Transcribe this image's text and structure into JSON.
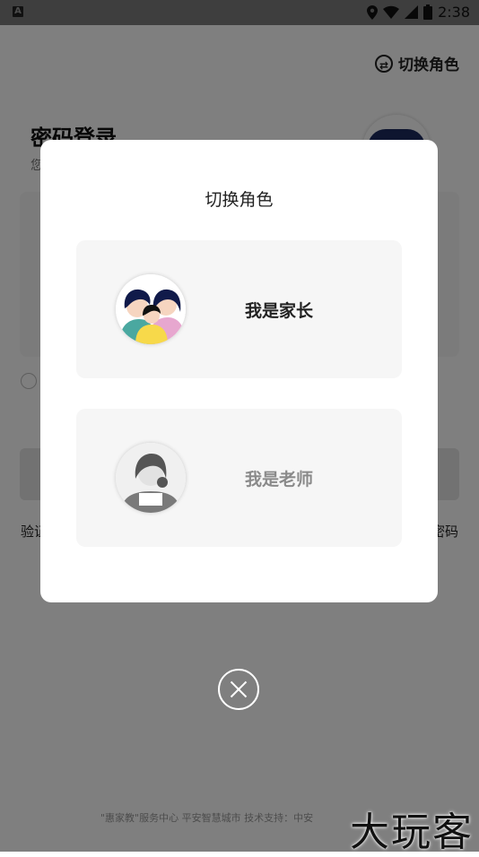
{
  "status_bar": {
    "time": "2:38",
    "icons": [
      "a-icon",
      "location-icon",
      "wifi-icon",
      "signal-icon",
      "battery-icon"
    ]
  },
  "background_page": {
    "switch_role_label": "切换角色",
    "login_title": "密码登录",
    "login_subtitle": "您",
    "link_left": "验证",
    "link_right": "密码",
    "footer": "\"惠家教\"服务中心 平安智慧城市 技术支持：中安"
  },
  "dialog": {
    "title": "切换角色",
    "roles": [
      {
        "label": "我是家长",
        "icon": "parent-avatar-icon",
        "active": true
      },
      {
        "label": "我是老师",
        "icon": "teacher-avatar-icon",
        "active": false
      }
    ]
  },
  "close_icon": "close-icon",
  "watermark": "大玩客"
}
